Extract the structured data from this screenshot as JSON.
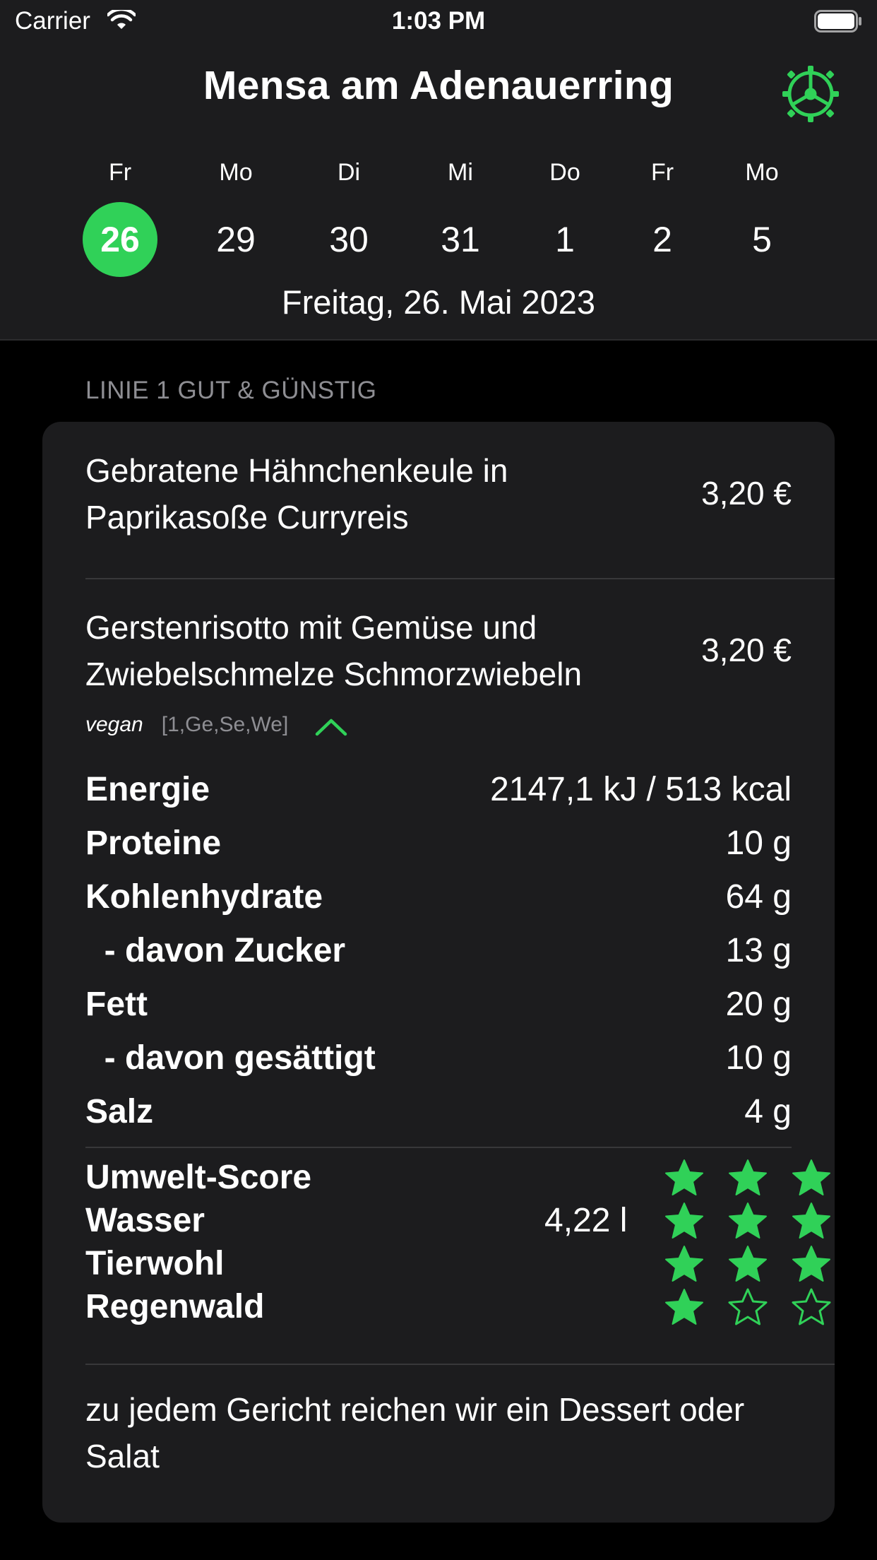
{
  "status_bar": {
    "carrier": "Carrier",
    "time": "1:03 PM"
  },
  "header": {
    "title": "Mensa am Adenauerring",
    "days": [
      {
        "name": "Fr",
        "num": "26",
        "selected": true
      },
      {
        "name": "Mo",
        "num": "29"
      },
      {
        "name": "Di",
        "num": "30"
      },
      {
        "name": "Mi",
        "num": "31"
      },
      {
        "name": "Do",
        "num": "1"
      },
      {
        "name": "Fr",
        "num": "2"
      },
      {
        "name": "Mo",
        "num": "5"
      }
    ],
    "selected_date": "Freitag, 26. Mai 2023"
  },
  "section": {
    "label": "LINIE 1 GUT & GÜNSTIG"
  },
  "meals": [
    {
      "name": "Gebratene Hähnchenkeule in Paprikasoße Curryreis",
      "price": "3,20 €"
    },
    {
      "name": "Gerstenrisotto mit Gemüse und Zwiebelschmelze Schmorzwiebeln",
      "price": "3,20 €",
      "tag": "vegan",
      "allergens": "[1,Ge,Se,We]"
    }
  ],
  "nutrition": [
    {
      "label": "Energie",
      "value": "2147,1 kJ / 513 kcal"
    },
    {
      "label": "Proteine",
      "value": "10 g"
    },
    {
      "label": "Kohlenhydrate",
      "value": "64 g"
    },
    {
      "label": "  - davon Zucker",
      "value": "13 g"
    },
    {
      "label": "Fett",
      "value": "20 g"
    },
    {
      "label": "  - davon gesättigt",
      "value": "10 g"
    },
    {
      "label": "Salz",
      "value": "4 g"
    }
  ],
  "scores": [
    {
      "label": "Umwelt-Score",
      "value": "",
      "stars": 3
    },
    {
      "label": "Wasser",
      "value": "4,22 l",
      "stars": 3
    },
    {
      "label": "Tierwohl",
      "value": "",
      "stars": 3
    },
    {
      "label": "Regenwald",
      "value": "",
      "stars": 1
    }
  ],
  "footer_note": "zu jedem Gericht reichen wir ein Dessert oder Salat",
  "colors": {
    "accent": "#30d158",
    "card": "#1c1c1e",
    "background": "#000000",
    "secondary_text": "#8e8e93"
  },
  "icons": {
    "settings": "gear-icon",
    "collapse": "chevron-up-icon",
    "star_filled": "star-filled-icon",
    "star_empty": "star-outline-icon"
  }
}
